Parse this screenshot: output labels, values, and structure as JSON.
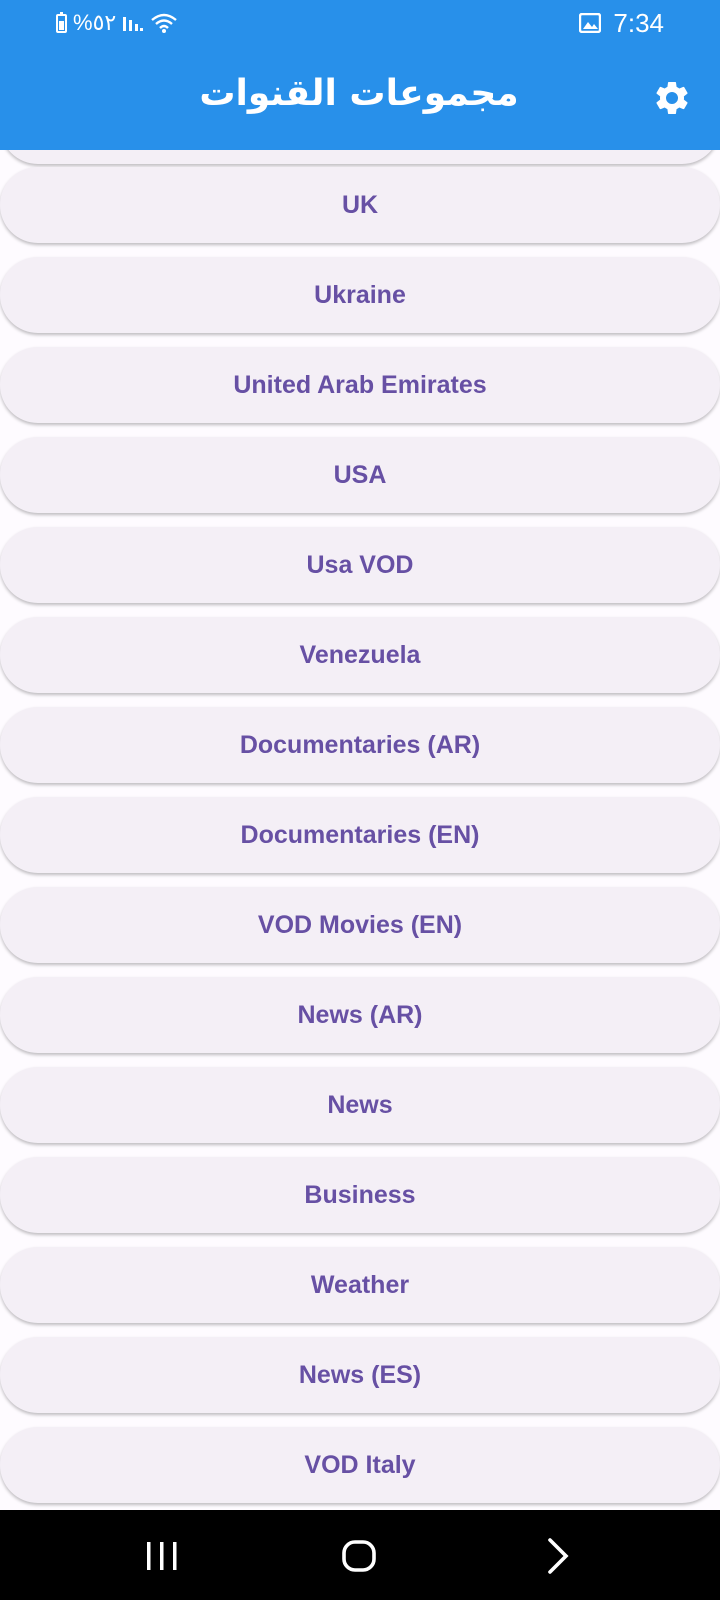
{
  "status_bar": {
    "battery_percent": "%٥٢",
    "time": "7:34",
    "icons": [
      "battery-icon",
      "signal-icon",
      "wifi-icon",
      "gallery-notification-icon"
    ]
  },
  "app_bar": {
    "title": "مجموعات القنوات",
    "settings_icon": "gear-icon",
    "background": "#2890ea"
  },
  "groups": [
    "UK",
    "Ukraine",
    "United Arab Emirates",
    "USA",
    "Usa VOD",
    "Venezuela",
    "Documentaries (AR)",
    "Documentaries (EN)",
    "VOD Movies (EN)",
    "News (AR)",
    "News",
    "Business",
    "Weather",
    "News (ES)",
    "VOD Italy"
  ],
  "nav_bar": {
    "buttons": [
      "recent-apps-button",
      "home-button",
      "back-button"
    ]
  }
}
